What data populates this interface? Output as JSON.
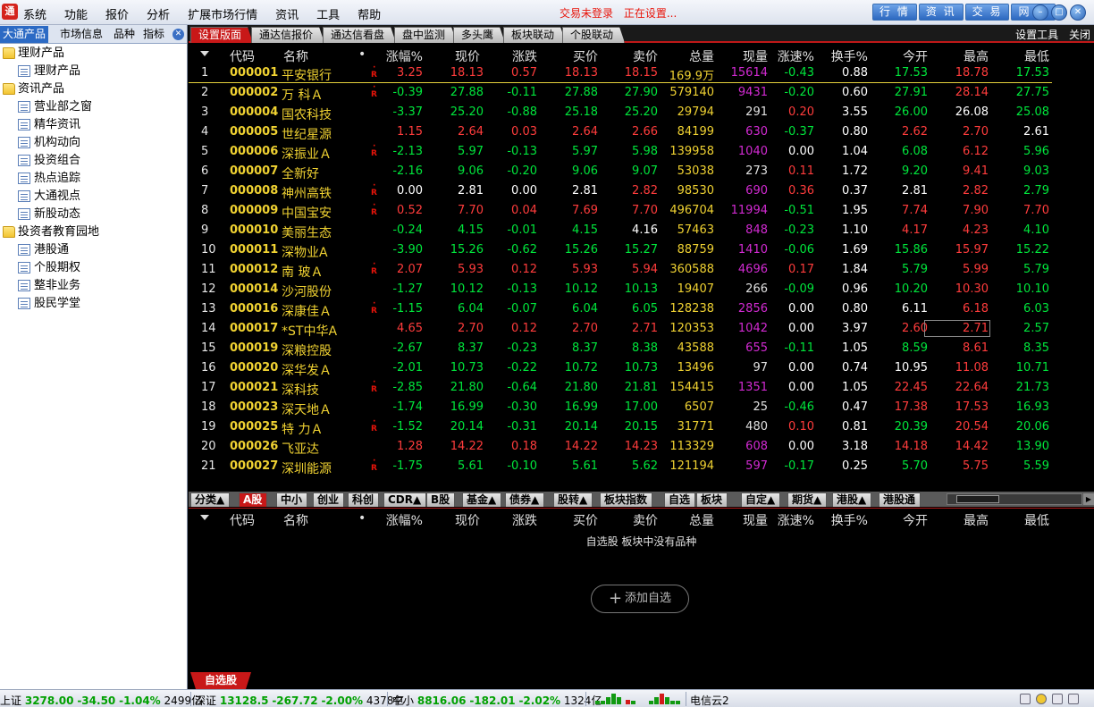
{
  "menubar": {
    "items": [
      "系统",
      "功能",
      "报价",
      "分析",
      "扩展市场行情",
      "资讯",
      "工具",
      "帮助"
    ],
    "status": [
      "交易未登录",
      "正在设置..."
    ],
    "quick_buttons": [
      "行 情",
      "资 讯",
      "交 易",
      "网 厅"
    ],
    "logo": "通"
  },
  "sidebar": {
    "tabs": [
      "大通产品",
      "市场信息",
      "品种",
      "指标"
    ],
    "close": "✕",
    "tree": [
      {
        "label": "理财产品",
        "type": "folder",
        "level": 0
      },
      {
        "label": "理财产品",
        "type": "doc",
        "level": 1
      },
      {
        "label": "资讯产品",
        "type": "folder",
        "level": 0
      },
      {
        "label": "营业部之窗",
        "type": "doc",
        "level": 1
      },
      {
        "label": "精华资讯",
        "type": "doc",
        "level": 1
      },
      {
        "label": "机构动向",
        "type": "doc",
        "level": 1
      },
      {
        "label": "投资组合",
        "type": "doc",
        "level": 1
      },
      {
        "label": "热点追踪",
        "type": "doc",
        "level": 1
      },
      {
        "label": "大通视点",
        "type": "doc",
        "level": 1
      },
      {
        "label": "新股动态",
        "type": "doc",
        "level": 1
      },
      {
        "label": "投资者教育园地",
        "type": "folder",
        "level": 0
      },
      {
        "label": "港股通",
        "type": "doc",
        "level": 1
      },
      {
        "label": "个股期权",
        "type": "doc",
        "level": 1
      },
      {
        "label": "整非业务",
        "type": "doc",
        "level": 1
      },
      {
        "label": "股民学堂",
        "type": "doc",
        "level": 1
      }
    ]
  },
  "top_tabs": [
    "设置版面",
    "通达信报价",
    "通达信看盘",
    "盘中监测",
    "多头鹰",
    "板块联动",
    "个股联动"
  ],
  "top_tools": [
    "设置工具",
    "关闭"
  ],
  "columns": [
    "代码",
    "名称",
    "•",
    "涨幅%",
    "现价",
    "涨跌",
    "买价",
    "卖价",
    "总量",
    "现量",
    "涨速%",
    "换手%",
    "今开",
    "最高",
    "最低"
  ],
  "rows": [
    {
      "i": "1",
      "code": "000001",
      "name": "平安银行",
      "r": true,
      "chg_pct": "3.25",
      "price": "18.13",
      "chg": "0.57",
      "bid": "18.13",
      "ask": "18.15",
      "vol": "169.9万",
      "now": "15614",
      "speed": "-0.43",
      "turn": "0.88",
      "open": "17.53",
      "high": "18.78",
      "low": "17.53"
    },
    {
      "i": "2",
      "code": "000002",
      "name": "万 科Ａ",
      "r": true,
      "chg_pct": "-0.39",
      "price": "27.88",
      "chg": "-0.11",
      "bid": "27.88",
      "ask": "27.90",
      "vol": "579140",
      "now": "9431",
      "speed": "-0.20",
      "turn": "0.60",
      "open": "27.91",
      "high": "28.14",
      "low": "27.75"
    },
    {
      "i": "3",
      "code": "000004",
      "name": "国农科技",
      "r": false,
      "chg_pct": "-3.37",
      "price": "25.20",
      "chg": "-0.88",
      "bid": "25.18",
      "ask": "25.20",
      "vol": "29794",
      "now": "291",
      "speed": "0.20",
      "turn": "3.55",
      "open": "26.00",
      "high": "26.08",
      "low": "25.08"
    },
    {
      "i": "4",
      "code": "000005",
      "name": "世纪星源",
      "r": false,
      "chg_pct": "1.15",
      "price": "2.64",
      "chg": "0.03",
      "bid": "2.64",
      "ask": "2.66",
      "vol": "84199",
      "now": "630",
      "speed": "-0.37",
      "turn": "0.80",
      "open": "2.62",
      "high": "2.70",
      "low": "2.61"
    },
    {
      "i": "5",
      "code": "000006",
      "name": "深振业Ａ",
      "r": true,
      "chg_pct": "-2.13",
      "price": "5.97",
      "chg": "-0.13",
      "bid": "5.97",
      "ask": "5.98",
      "vol": "139958",
      "now": "1040",
      "speed": "0.00",
      "turn": "1.04",
      "open": "6.08",
      "high": "6.12",
      "low": "5.96"
    },
    {
      "i": "6",
      "code": "000007",
      "name": "全新好",
      "r": false,
      "chg_pct": "-2.16",
      "price": "9.06",
      "chg": "-0.20",
      "bid": "9.06",
      "ask": "9.07",
      "vol": "53038",
      "now": "273",
      "speed": "0.11",
      "turn": "1.72",
      "open": "9.20",
      "high": "9.41",
      "low": "9.03"
    },
    {
      "i": "7",
      "code": "000008",
      "name": "神州高铁",
      "r": true,
      "chg_pct": "0.00",
      "price": "2.81",
      "chg": "0.00",
      "bid": "2.81",
      "ask": "2.82",
      "vol": "98530",
      "now": "690",
      "speed": "0.36",
      "turn": "0.37",
      "open": "2.81",
      "high": "2.82",
      "low": "2.79"
    },
    {
      "i": "8",
      "code": "000009",
      "name": "中国宝安",
      "r": true,
      "chg_pct": "0.52",
      "price": "7.70",
      "chg": "0.04",
      "bid": "7.69",
      "ask": "7.70",
      "vol": "496704",
      "now": "11994",
      "speed": "-0.51",
      "turn": "1.95",
      "open": "7.74",
      "high": "7.90",
      "low": "7.70"
    },
    {
      "i": "9",
      "code": "000010",
      "name": "美丽生态",
      "r": false,
      "chg_pct": "-0.24",
      "price": "4.15",
      "chg": "-0.01",
      "bid": "4.15",
      "ask": "4.16",
      "vol": "57463",
      "now": "848",
      "speed": "-0.23",
      "turn": "1.10",
      "open": "4.17",
      "high": "4.23",
      "low": "4.10"
    },
    {
      "i": "10",
      "code": "000011",
      "name": "深物业A",
      "r": false,
      "chg_pct": "-3.90",
      "price": "15.26",
      "chg": "-0.62",
      "bid": "15.26",
      "ask": "15.27",
      "vol": "88759",
      "now": "1410",
      "speed": "-0.06",
      "turn": "1.69",
      "open": "15.86",
      "high": "15.97",
      "low": "15.22"
    },
    {
      "i": "11",
      "code": "000012",
      "name": "南 玻Ａ",
      "r": true,
      "chg_pct": "2.07",
      "price": "5.93",
      "chg": "0.12",
      "bid": "5.93",
      "ask": "5.94",
      "vol": "360588",
      "now": "4696",
      "speed": "0.17",
      "turn": "1.84",
      "open": "5.79",
      "high": "5.99",
      "low": "5.79"
    },
    {
      "i": "12",
      "code": "000014",
      "name": "沙河股份",
      "r": false,
      "chg_pct": "-1.27",
      "price": "10.12",
      "chg": "-0.13",
      "bid": "10.12",
      "ask": "10.13",
      "vol": "19407",
      "now": "266",
      "speed": "-0.09",
      "turn": "0.96",
      "open": "10.20",
      "high": "10.30",
      "low": "10.10"
    },
    {
      "i": "13",
      "code": "000016",
      "name": "深康佳Ａ",
      "r": true,
      "chg_pct": "-1.15",
      "price": "6.04",
      "chg": "-0.07",
      "bid": "6.04",
      "ask": "6.05",
      "vol": "128238",
      "now": "2856",
      "speed": "0.00",
      "turn": "0.80",
      "open": "6.11",
      "high": "6.18",
      "low": "6.03"
    },
    {
      "i": "14",
      "code": "000017",
      "name": "*ST中华A",
      "r": false,
      "chg_pct": "4.65",
      "price": "2.70",
      "chg": "0.12",
      "bid": "2.70",
      "ask": "2.71",
      "vol": "120353",
      "now": "1042",
      "speed": "0.00",
      "turn": "3.97",
      "open": "2.60",
      "high": "2.71",
      "low": "2.57"
    },
    {
      "i": "15",
      "code": "000019",
      "name": "深粮控股",
      "r": false,
      "chg_pct": "-2.67",
      "price": "8.37",
      "chg": "-0.23",
      "bid": "8.37",
      "ask": "8.38",
      "vol": "43588",
      "now": "655",
      "speed": "-0.11",
      "turn": "1.05",
      "open": "8.59",
      "high": "8.61",
      "low": "8.35"
    },
    {
      "i": "16",
      "code": "000020",
      "name": "深华发Ａ",
      "r": false,
      "chg_pct": "-2.01",
      "price": "10.73",
      "chg": "-0.22",
      "bid": "10.72",
      "ask": "10.73",
      "vol": "13496",
      "now": "97",
      "speed": "0.00",
      "turn": "0.74",
      "open": "10.95",
      "high": "11.08",
      "low": "10.71"
    },
    {
      "i": "17",
      "code": "000021",
      "name": "深科技",
      "r": true,
      "chg_pct": "-2.85",
      "price": "21.80",
      "chg": "-0.64",
      "bid": "21.80",
      "ask": "21.81",
      "vol": "154415",
      "now": "1351",
      "speed": "0.00",
      "turn": "1.05",
      "open": "22.45",
      "high": "22.64",
      "low": "21.73"
    },
    {
      "i": "18",
      "code": "000023",
      "name": "深天地Ａ",
      "r": false,
      "chg_pct": "-1.74",
      "price": "16.99",
      "chg": "-0.30",
      "bid": "16.99",
      "ask": "17.00",
      "vol": "6507",
      "now": "25",
      "speed": "-0.46",
      "turn": "0.47",
      "open": "17.38",
      "high": "17.53",
      "low": "16.93"
    },
    {
      "i": "19",
      "code": "000025",
      "name": "特 力Ａ",
      "r": true,
      "chg_pct": "-1.52",
      "price": "20.14",
      "chg": "-0.31",
      "bid": "20.14",
      "ask": "20.15",
      "vol": "31771",
      "now": "480",
      "speed": "0.10",
      "turn": "0.81",
      "open": "20.39",
      "high": "20.54",
      "low": "20.06"
    },
    {
      "i": "20",
      "code": "000026",
      "name": "飞亚达",
      "r": false,
      "chg_pct": "1.28",
      "price": "14.22",
      "chg": "0.18",
      "bid": "14.22",
      "ask": "14.23",
      "vol": "113329",
      "now": "608",
      "speed": "0.00",
      "turn": "3.18",
      "open": "14.18",
      "high": "14.42",
      "low": "13.90"
    },
    {
      "i": "21",
      "code": "000027",
      "name": "深圳能源",
      "r": true,
      "chg_pct": "-1.75",
      "price": "5.61",
      "chg": "-0.10",
      "bid": "5.61",
      "ask": "5.62",
      "vol": "121194",
      "now": "597",
      "speed": "-0.17",
      "turn": "0.25",
      "open": "5.70",
      "high": "5.75",
      "low": "5.59"
    }
  ],
  "category_tabs": [
    "分类▲",
    "A股",
    "中小",
    "创业",
    "科创",
    "CDR▲",
    "B股",
    "基金▲",
    "债券▲",
    "股转▲",
    "板块指数",
    "自选",
    "板块",
    "自定▲",
    "期货▲",
    "港股▲",
    "港股通"
  ],
  "lower_columns": [
    "代码",
    "名称",
    "•",
    "涨幅%",
    "现价",
    "涨跌",
    "买价",
    "卖价",
    "总量",
    "现量",
    "涨速%",
    "换手%",
    "今开",
    "最高",
    "最低"
  ],
  "empty_message": "自选股 板块中没有品种",
  "add_watch": {
    "plus": "+",
    "label": "添加自选"
  },
  "watch_tab": "自选股",
  "statusbar": {
    "sh": {
      "label": "上证",
      "value": "3278.00",
      "chg": "-34.50",
      "pct": "-1.04%",
      "amt": "2499亿"
    },
    "sz": {
      "label": "深证",
      "value": "13128.5",
      "chg": "-267.72",
      "pct": "-2.00%",
      "amt": "4378亿"
    },
    "zx": {
      "label": "中小",
      "value": "8816.06",
      "chg": "-182.01",
      "pct": "-2.02%",
      "amt": "1324亿"
    },
    "server": "电信云2"
  },
  "colors": {
    "up": "#ff3c3c",
    "down": "#00e63c",
    "accent": "#c81818",
    "code": "#f0d232"
  }
}
